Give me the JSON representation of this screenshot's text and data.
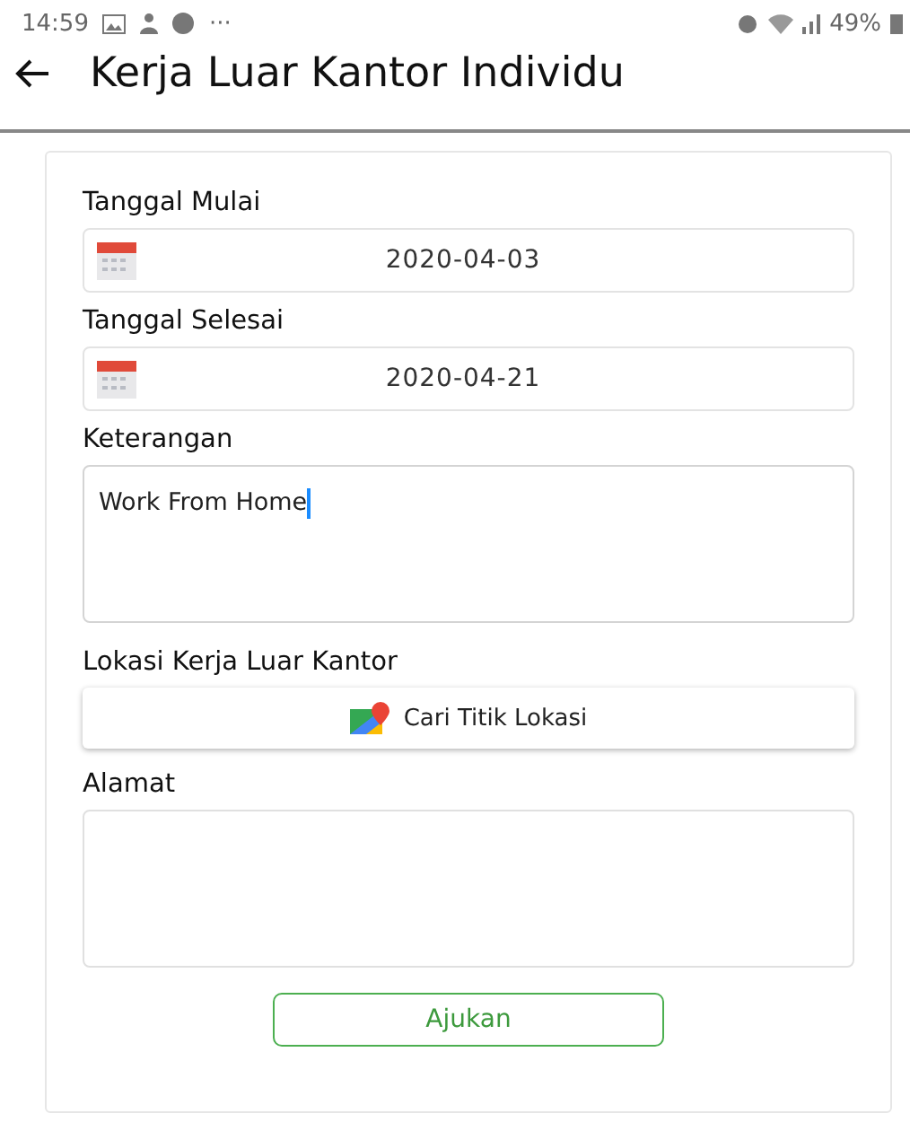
{
  "status_bar": {
    "time": "14:59",
    "more": "···",
    "battery": "49%"
  },
  "header": {
    "title": "Kerja Luar Kantor Individu"
  },
  "form": [
    {
      "kind": "date",
      "label": "Tanggal Mulai",
      "value": "2020-04-03"
    },
    {
      "kind": "date",
      "label": "Tanggal Selesai",
      "value": "2020-04-21"
    },
    {
      "kind": "textarea",
      "label": "Keterangan",
      "value": "Work From Home",
      "focused": true
    },
    {
      "kind": "location",
      "label": "Lokasi Kerja Luar Kantor",
      "button": "Cari Titik Lokasi"
    },
    {
      "kind": "textarea",
      "label": "Alamat",
      "focused": false
    }
  ],
  "submit": "Ajukan"
}
